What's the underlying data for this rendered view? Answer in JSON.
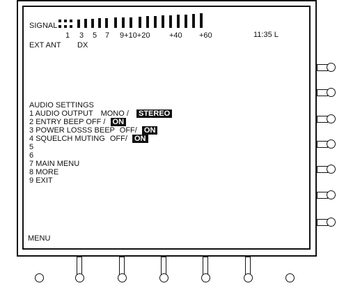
{
  "signal": {
    "label": "SIGNAL",
    "scale": [
      "1",
      "3",
      "5",
      "7",
      "9+10+20",
      "+40",
      "+60"
    ]
  },
  "clock": "11:35 L",
  "antenna": {
    "source": "EXT ANT",
    "mode": "DX"
  },
  "menu": {
    "title": "AUDIO SETTINGS",
    "items": [
      {
        "num": "1",
        "label": "AUDIO OUTPUT",
        "opt1": "MONO",
        "sep": "/",
        "opt2": "STEREO"
      },
      {
        "num": "2",
        "label": "ENTRY BEEP",
        "opt1": "OFF",
        "sep": "/",
        "opt2": "ON"
      },
      {
        "num": "3",
        "label": "POWER LOSSS BEEP",
        "opt1": "OFF",
        "sep": "/",
        "opt2": "ON"
      },
      {
        "num": "4",
        "label": "SQUELCH MUTING",
        "opt1": "OFF",
        "sep": "/",
        "opt2": "ON"
      },
      {
        "num": "5",
        "label": ""
      },
      {
        "num": "6",
        "label": ""
      },
      {
        "num": "7",
        "label": "MAIN MENU"
      },
      {
        "num": "8",
        "label": "MORE"
      },
      {
        "num": "9",
        "label": "EXIT"
      }
    ]
  },
  "footer": {
    "label": "MENU"
  }
}
